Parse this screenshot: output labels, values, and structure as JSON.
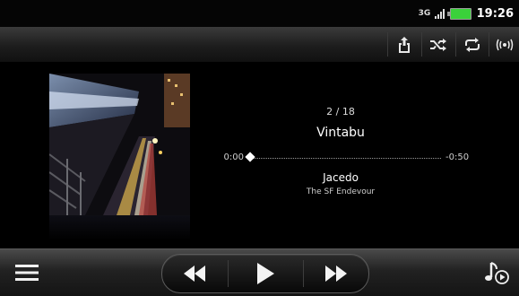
{
  "status_bar": {
    "network": "3G",
    "time": "19:26",
    "icons": [
      "network-3g-icon",
      "signal-icon",
      "battery-icon"
    ],
    "battery_color": "#3ad13a"
  },
  "toolbar": {
    "buttons": [
      "share-icon",
      "shuffle-icon",
      "repeat-icon",
      "broadcast-icon"
    ]
  },
  "player": {
    "track_index": "2 / 18",
    "title": "Vintabu",
    "elapsed": "0:00",
    "remaining": "-0:50",
    "progress": 0.0,
    "artist": "Jacedo",
    "album": "The SF Endevour"
  },
  "bottom_bar": {
    "buttons": [
      "menu-icon",
      "rewind-icon",
      "play-icon",
      "fast-forward-icon",
      "now-playing-icon"
    ]
  }
}
